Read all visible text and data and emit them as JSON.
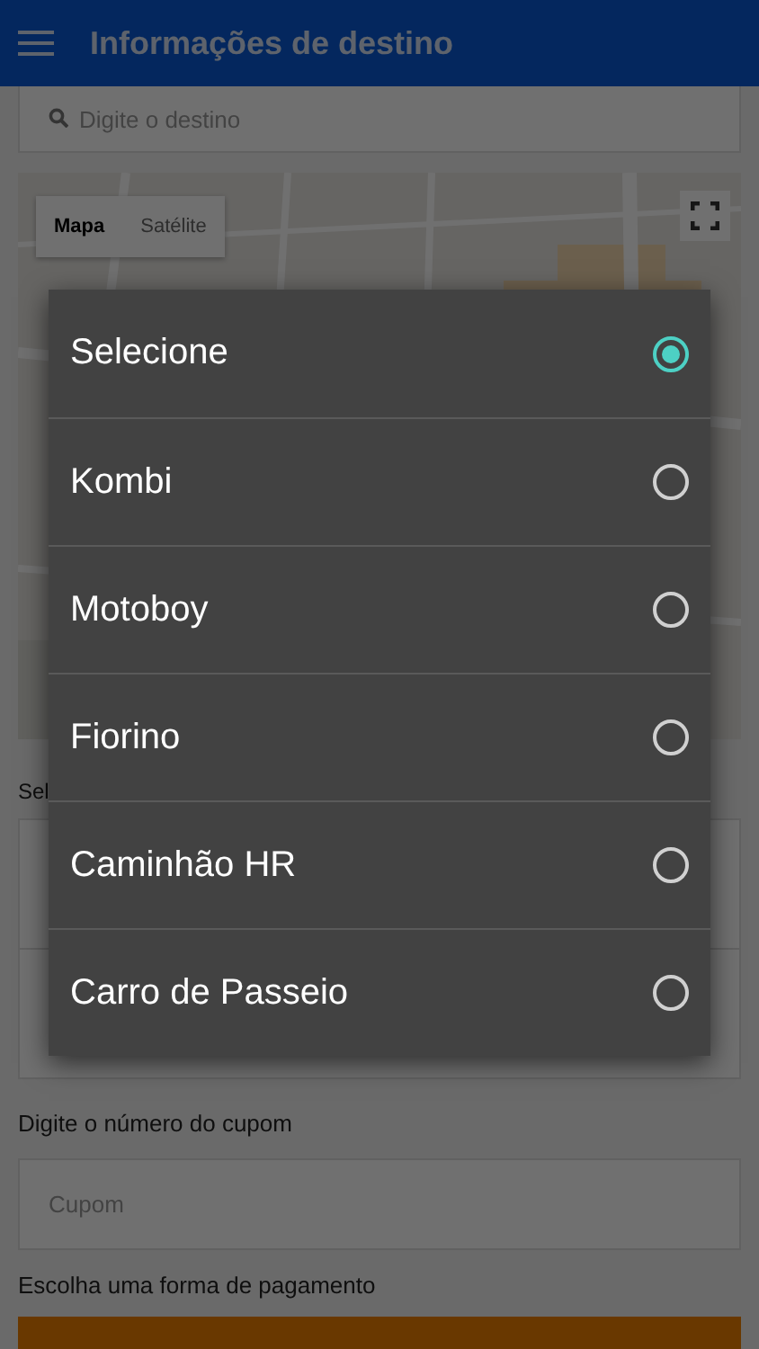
{
  "header": {
    "title": "Informações de destino"
  },
  "destination_search": {
    "placeholder": "Digite o destino"
  },
  "map": {
    "kind": "picture",
    "map_types": [
      {
        "label": "Mapa",
        "selected": true
      },
      {
        "label": "Satélite",
        "selected": false
      }
    ]
  },
  "vehicle_label": "Sel",
  "coupon": {
    "label": "Digite o número do cupom",
    "placeholder": "Cupom"
  },
  "payment": {
    "label": "Escolha uma forma de pagamento"
  },
  "vehicle_dialog": {
    "options": [
      {
        "label": "Selecione",
        "selected": true
      },
      {
        "label": "Kombi",
        "selected": false
      },
      {
        "label": "Motoboy",
        "selected": false
      },
      {
        "label": "Fiorino",
        "selected": false
      },
      {
        "label": "Caminhão HR",
        "selected": false
      },
      {
        "label": "Carro de Passeio",
        "selected": false
      }
    ]
  }
}
